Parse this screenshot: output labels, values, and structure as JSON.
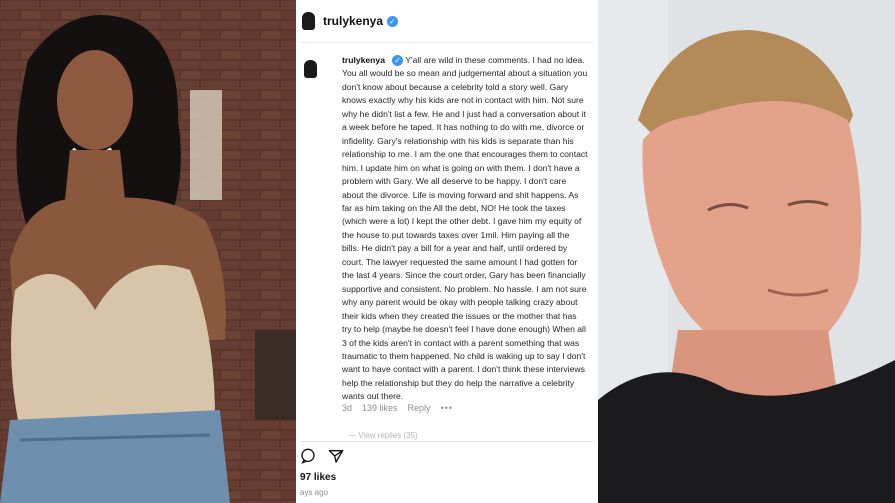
{
  "post": {
    "username": "trulykenya",
    "verified_icon": "verified-badge-icon",
    "comment_username": "trulykenya",
    "comment_text": "Y'all are wild in these comments. I had no idea. You all would be so mean and judgemental about a situation you don't know about because a celebrity told a story well. Gary knows exactly why his kids are not in contact with him. Not sure why he didn't list a few. He and I just had a conversation about it a week before he taped. It has nothing to do with me, divorce or infidelity. Gary's relationship with his kids is separate than his relationship to me. I am the one that encourages them to contact him. I update him on what is going on with them. I don't have a problem with Gary. We all deserve to be happy. I don't care about the divorce. Life is moving forward and shit happens. As far as him taking on the All the debt, NO! He took the taxes (which were a lot) I kept the other debt. I gave him my equity of the house to put towards taxes over 1mil. Him paying all the bills. He didn't pay a bill for a year and half, until ordered by court. The lawyer requested the same amount I had gotten for the last 4 years. Since the court order, Gary has been financially supportive and consistent. No problem. No hassle. I am not sure why any parent would be okay with people talking crazy about their kids when they created the issues or the mother that has try to help (maybe he doesn't feel I have done enough) When all 3 of the kids aren't in contact with a parent something that was traumatic to them happened. No child is waking up to say I don't want to have contact with a parent. I don't think these interviews help the relationship but they do help the narrative a celebrity wants out there.",
    "time": "3d",
    "comment_likes": "139 likes",
    "reply_label": "Reply",
    "more_label": "•••",
    "hidden_replies": "— View replies (35)",
    "likes": "97 likes",
    "ago": "ays ago"
  },
  "icons": {
    "comment": "comment-icon",
    "share": "share-icon"
  },
  "colors": {
    "verified": "#3897f0",
    "meta_gray": "#8e8e8e"
  }
}
